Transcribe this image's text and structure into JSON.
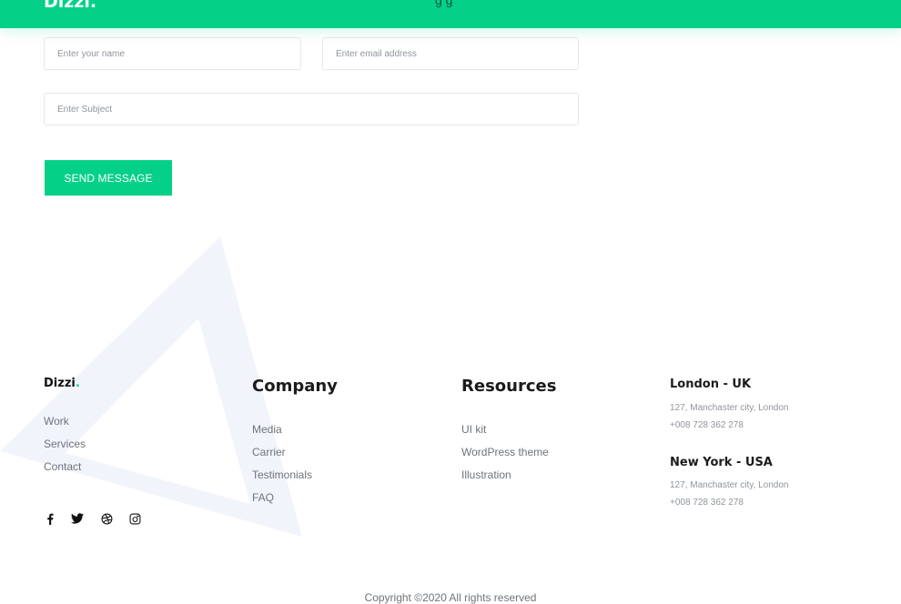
{
  "header": {
    "brand": "Dizzi",
    "brand_dot": ".",
    "nav_partial": "g   g"
  },
  "form": {
    "name_placeholder": "Enter your name",
    "email_placeholder": "Enter email address",
    "subject_placeholder": "Enter Subject",
    "send_label": "SEND MESSAGE"
  },
  "footer": {
    "brand": "Dizzi",
    "brand_dot": ".",
    "brand_links": [
      "Work",
      "Services",
      "Contact"
    ],
    "company": {
      "title": "Company",
      "links": [
        "Media",
        "Carrier",
        "Testimonials",
        "FAQ"
      ]
    },
    "resources": {
      "title": "Resources",
      "links": [
        "UI kit",
        "WordPress theme",
        "Illustration"
      ]
    },
    "offices": [
      {
        "city": "London - UK",
        "address": "127, Manchaster city, London",
        "phone": "+008 728 362 278"
      },
      {
        "city": "New York - USA",
        "address": "127, Manchaster city, London",
        "phone": "+008 728 362 278"
      }
    ],
    "social_icons": [
      "facebook-icon",
      "twitter-icon",
      "dribbble-icon",
      "instagram-icon"
    ],
    "copyright": "Copyright ©2020 All rights reserved"
  },
  "colors": {
    "accent": "#04d088",
    "heading": "#1b1b1b",
    "muted_text": "#6e737b",
    "triangle_tint": "#f2f4fc"
  }
}
